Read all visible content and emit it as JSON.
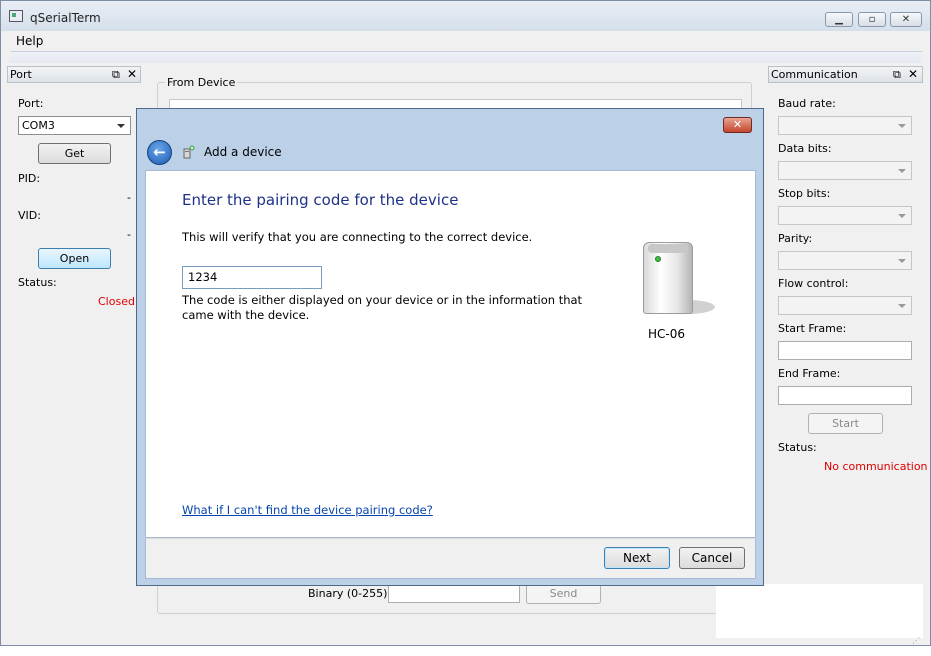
{
  "app": {
    "title": "qSerialTerm",
    "menu": {
      "help": "Help"
    }
  },
  "port_pane": {
    "title": "Port",
    "port_label": "Port:",
    "port_value": "COM3",
    "get_button": "Get",
    "pid_label": "PID:",
    "pid_value": "-",
    "vid_label": "VID:",
    "vid_value": "-",
    "open_button": "Open",
    "status_label": "Status:",
    "status_value": "Closed",
    "status_color": "#e00000"
  },
  "from_device": {
    "label": "From Device"
  },
  "send_row": {
    "binary_label": "Binary (0-255):",
    "send_button": "Send"
  },
  "comm_pane": {
    "title": "Communication",
    "baud_label": "Baud rate:",
    "data_bits_label": "Data bits:",
    "stop_bits_label": "Stop bits:",
    "parity_label": "Parity:",
    "flow_control_label": "Flow control:",
    "start_frame_label": "Start Frame:",
    "end_frame_label": "End Frame:",
    "start_button": "Start",
    "status_label": "Status:",
    "status_value": "No communication"
  },
  "dialog": {
    "title": "Add a device",
    "heading": "Enter the pairing code for the device",
    "verify_text": "This will verify that you are connecting to the correct device.",
    "code_value": "1234",
    "hint_line1": "The code is either displayed on your device or in the information that",
    "hint_line2": "came with the device.",
    "device_name": "HC-06",
    "help_link": "What if I can't find the device pairing code?",
    "next_button": "Next",
    "cancel_button": "Cancel",
    "close_glyph": "✕",
    "back_glyph": "←"
  },
  "colors": {
    "heading_blue": "#1e3287",
    "link_blue": "#0645ad",
    "status_red": "#e00000"
  }
}
